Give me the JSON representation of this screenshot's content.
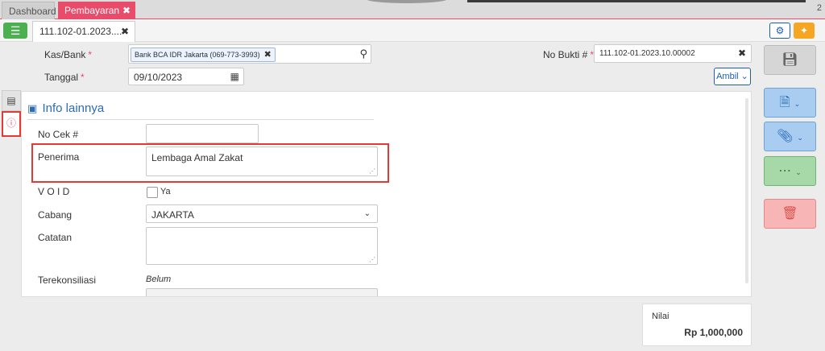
{
  "tabs": {
    "dashboard": "Dashboard",
    "pembayaran": "Pembayaran",
    "close": "✖",
    "count": "2"
  },
  "doc_tab": {
    "label": "111.102-01.2023....",
    "close": "✖"
  },
  "header": {
    "kas_bank_label": "Kas/Bank",
    "kas_bank_value": "Bank BCA IDR Jakarta (069-773-3993)",
    "tanggal_label": "Tanggal",
    "tanggal_value": "09/10/2023",
    "no_bukti_label": "No Bukti #",
    "no_bukti_value": "111.102-01.2023.10.00002",
    "required_mark": "*",
    "ambil_label": "Ambil"
  },
  "panel": {
    "title": "Info lainnya",
    "no_cek_label": "No Cek #",
    "no_cek_value": "",
    "penerima_label": "Penerima",
    "penerima_value": "Lembaga Amal Zakat",
    "void_label": "V O I D",
    "void_option": "Ya",
    "cabang_label": "Cabang",
    "cabang_value": "JAKARTA",
    "catatan_label": "Catatan",
    "catatan_value": "",
    "terekonsiliasi_label": "Terekonsiliasi",
    "terekonsiliasi_value": "Belum"
  },
  "summary": {
    "nilai_label": "Nilai",
    "nilai_value": "Rp 1,000,000"
  },
  "icons": [
    "list-icon",
    "gear-icon",
    "lightbulb-icon",
    "search-icon",
    "calendar-icon",
    "clear-icon",
    "document-icon",
    "info-icon",
    "save-icon",
    "paperclip-icon",
    "more-icon",
    "trash-icon"
  ],
  "colors": {
    "accent": "#e94b6a",
    "primary": "#1c5fb0",
    "highlight": "#e53935"
  }
}
